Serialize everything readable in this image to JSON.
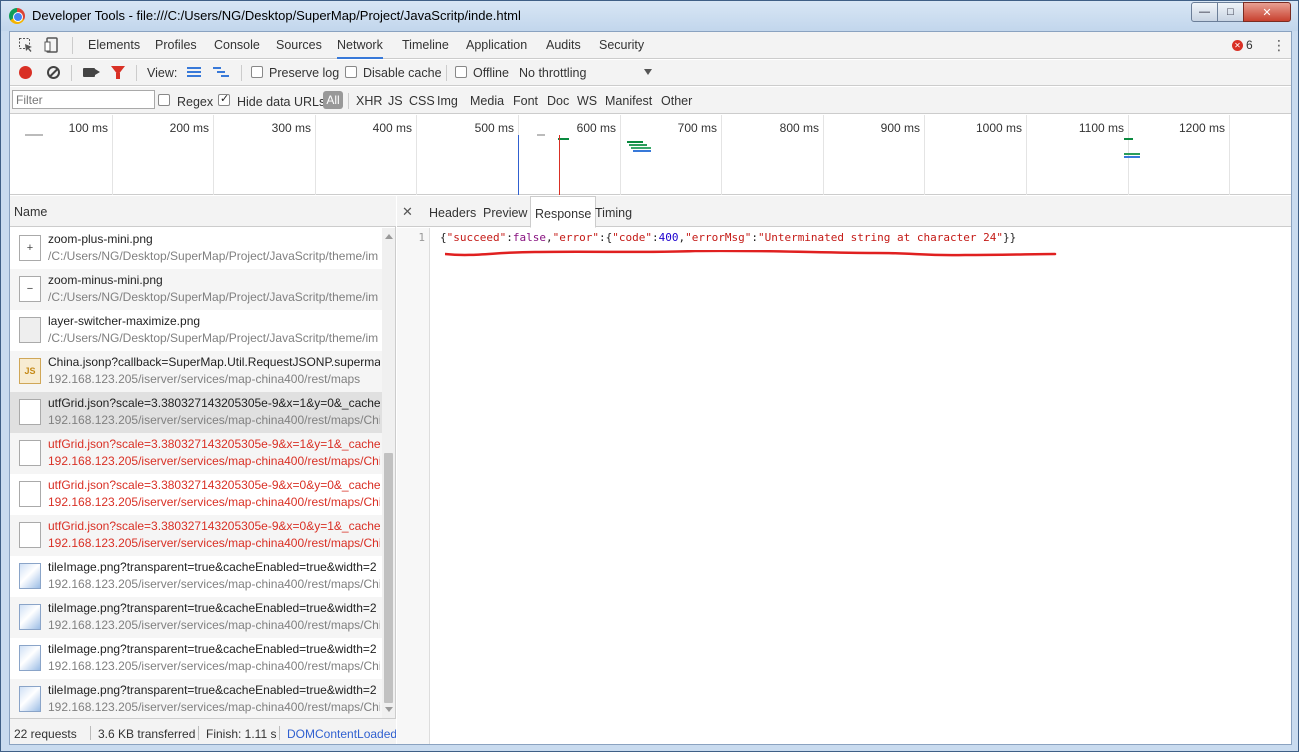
{
  "window": {
    "title": "Developer Tools - file:///C:/Users/NG/Desktop/SuperMap/Project/JavaScritp/inde.html",
    "minimize_glyph": "—",
    "maximize_glyph": "□",
    "close_glyph": "✕"
  },
  "main_tabs": [
    "Elements",
    "Profiles",
    "Console",
    "Sources",
    "Network",
    "Timeline",
    "Application",
    "Audits",
    "Security"
  ],
  "active_main_tab": "Network",
  "error_count": "6",
  "network_toolbar": {
    "view_label": "View:",
    "preserve_log": "Preserve log",
    "disable_cache": "Disable cache",
    "offline": "Offline",
    "throttling": "No throttling"
  },
  "filter_bar": {
    "placeholder": "Filter",
    "regex": "Regex",
    "hide_data_urls": "Hide data URLs",
    "all": "All",
    "types": [
      "XHR",
      "JS",
      "CSS",
      "Img",
      "Media",
      "Font",
      "Doc",
      "WS",
      "Manifest",
      "Other"
    ]
  },
  "overview": {
    "ticks": [
      "100 ms",
      "200 ms",
      "300 ms",
      "400 ms",
      "500 ms",
      "600 ms",
      "700 ms",
      "800 ms",
      "900 ms",
      "1000 ms",
      "1100 ms",
      "1200 ms",
      "1"
    ]
  },
  "request_list": {
    "header": "Name",
    "items": [
      {
        "name": "zoom-plus-mini.png",
        "path": "/C:/Users/NG/Desktop/SuperMap/Project/JavaScritp/theme/im",
        "icon": "plus-image-icon",
        "glyph": "+",
        "status": "ok"
      },
      {
        "name": "zoom-minus-mini.png",
        "path": "/C:/Users/NG/Desktop/SuperMap/Project/JavaScritp/theme/im",
        "icon": "minus-image-icon",
        "glyph": "−",
        "status": "ok"
      },
      {
        "name": "layer-switcher-maximize.png",
        "path": "/C:/Users/NG/Desktop/SuperMap/Project/JavaScritp/theme/im",
        "icon": "layer-image-icon",
        "glyph": "",
        "status": "ok"
      },
      {
        "name": "China.jsonp?callback=SuperMap.Util.RequestJSONP.supermap_",
        "path": "192.168.123.205/iserver/services/map-china400/rest/maps",
        "icon": "js-file-icon",
        "glyph": "JS",
        "status": "ok"
      },
      {
        "name": "utfGrid.json?scale=3.380327143205305e-9&x=1&y=0&_cache",
        "path": "192.168.123.205/iserver/services/map-china400/rest/maps/Chi",
        "icon": "blank-file-icon",
        "glyph": "",
        "status": "selected"
      },
      {
        "name": "utfGrid.json?scale=3.380327143205305e-9&x=1&y=1&_cache",
        "path": "192.168.123.205/iserver/services/map-china400/rest/maps/Chi",
        "icon": "blank-file-icon",
        "glyph": "",
        "status": "error"
      },
      {
        "name": "utfGrid.json?scale=3.380327143205305e-9&x=0&y=0&_cache",
        "path": "192.168.123.205/iserver/services/map-china400/rest/maps/Chi",
        "icon": "blank-file-icon",
        "glyph": "",
        "status": "error"
      },
      {
        "name": "utfGrid.json?scale=3.380327143205305e-9&x=0&y=1&_cache",
        "path": "192.168.123.205/iserver/services/map-china400/rest/maps/Chi",
        "icon": "blank-file-icon",
        "glyph": "",
        "status": "error"
      },
      {
        "name": "tileImage.png?transparent=true&cacheEnabled=true&width=2",
        "path": "192.168.123.205/iserver/services/map-china400/rest/maps/Chi",
        "icon": "map-tile-icon",
        "glyph": "",
        "status": "ok"
      },
      {
        "name": "tileImage.png?transparent=true&cacheEnabled=true&width=2",
        "path": "192.168.123.205/iserver/services/map-china400/rest/maps/Chi",
        "icon": "map-tile-icon",
        "glyph": "",
        "status": "ok"
      },
      {
        "name": "tileImage.png?transparent=true&cacheEnabled=true&width=2",
        "path": "192.168.123.205/iserver/services/map-china400/rest/maps/Chi",
        "icon": "map-tile-icon",
        "glyph": "",
        "status": "ok"
      },
      {
        "name": "tileImage.png?transparent=true&cacheEnabled=true&width=2",
        "path": "192.168.123.205/iserver/services/map-china400/rest/maps/Chi",
        "icon": "map-tile-icon",
        "glyph": "",
        "status": "ok"
      }
    ]
  },
  "status_bar": {
    "requests": "22 requests",
    "transferred": "3.6 KB transferred",
    "finish": "Finish: 1.11 s",
    "dom_loaded": "DOMContentLoaded..."
  },
  "detail": {
    "close_glyph": "✕",
    "tabs": [
      "Headers",
      "Preview",
      "Response",
      "Timing"
    ],
    "active_tab": "Response",
    "line_number": "1",
    "response": {
      "key_succeed": "\"succeed\"",
      "val_succeed": "false",
      "key_error": "\"error\"",
      "key_code": "\"code\"",
      "val_code": "400",
      "key_errorMsg": "\"errorMsg\"",
      "val_errorMsg": "\"Unterminated string at character 24\""
    }
  },
  "colors": {
    "accent": "#3879d9",
    "error_red": "#d93025",
    "annotation_red": "#e02020"
  }
}
